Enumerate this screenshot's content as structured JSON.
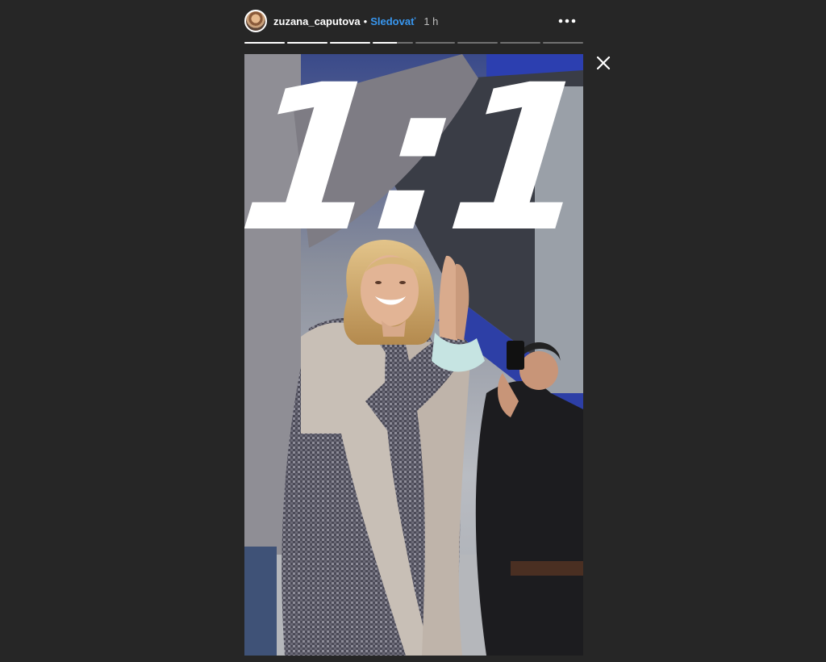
{
  "header": {
    "username": "zuzana_caputova",
    "separator": "•",
    "follow_label": "Sledovať",
    "time_ago": "1 h"
  },
  "progress": {
    "segments": [
      1,
      1,
      1,
      0.6,
      0,
      0,
      0,
      0
    ]
  },
  "story": {
    "score_text": "1:1"
  },
  "icons": {
    "avatar": "avatar",
    "more": "more-horizontal-icon",
    "close": "close-icon"
  },
  "colors": {
    "background": "#262626",
    "follow": "#3897f0",
    "text": "#ffffff"
  }
}
